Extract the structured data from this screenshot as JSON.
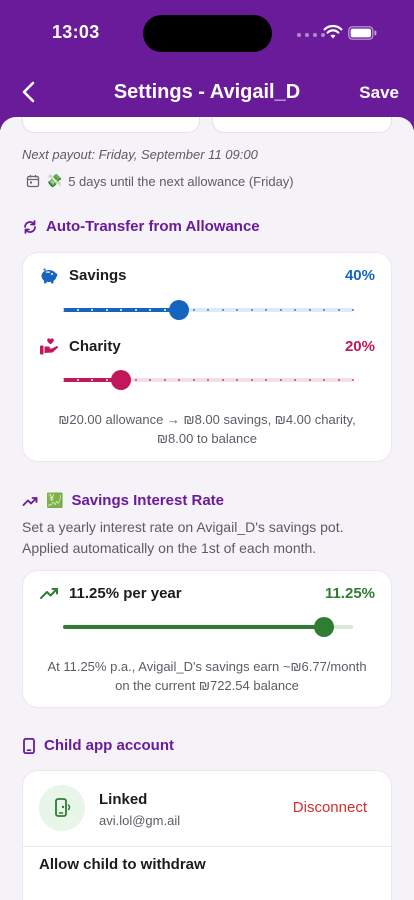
{
  "status_bar": {
    "time": "13:03"
  },
  "header": {
    "title": "Settings - Avigail_D",
    "save_label": "Save"
  },
  "payout": {
    "next_payout": "Next payout: Friday, September 11 09:00",
    "allowance_emoji": "💸",
    "countdown": "5 days until the next allowance (Friday)"
  },
  "auto_transfer": {
    "title": "Auto-Transfer from Allowance",
    "savings": {
      "label": "Savings",
      "percent_text": "40%",
      "value": 40,
      "color": "#1565c0"
    },
    "charity": {
      "label": "Charity",
      "percent_text": "20%",
      "value": 20,
      "color": "#c2185b"
    },
    "summary_line1": "₪20.00 allowance → ₪8.00 savings, ₪4.00 charity,",
    "summary_line2": "₪8.00 to balance"
  },
  "interest": {
    "title": "Savings Interest Rate",
    "title_emoji": "💹",
    "description_line1": "Set a yearly interest rate on Avigail_D's savings pot.",
    "description_line2": "Applied automatically on the 1st of each month.",
    "rate_label": "11.25% per year",
    "rate_value_text": "11.25%",
    "slider_fraction": 0.9,
    "color": "#2e7d32",
    "summary_line1": "At 11.25% p.a., Avigail_D's savings earn ~₪6.77/month",
    "summary_line2": "on the current ₪722.54 balance"
  },
  "child_account": {
    "title": "Child app account",
    "status": "Linked",
    "email": "avi.lol@gm.ail",
    "disconnect_label": "Disconnect",
    "withdraw_label": "Allow child to withdraw"
  },
  "colors": {
    "primary": "#6a1b9a",
    "danger": "#d32f2f"
  }
}
